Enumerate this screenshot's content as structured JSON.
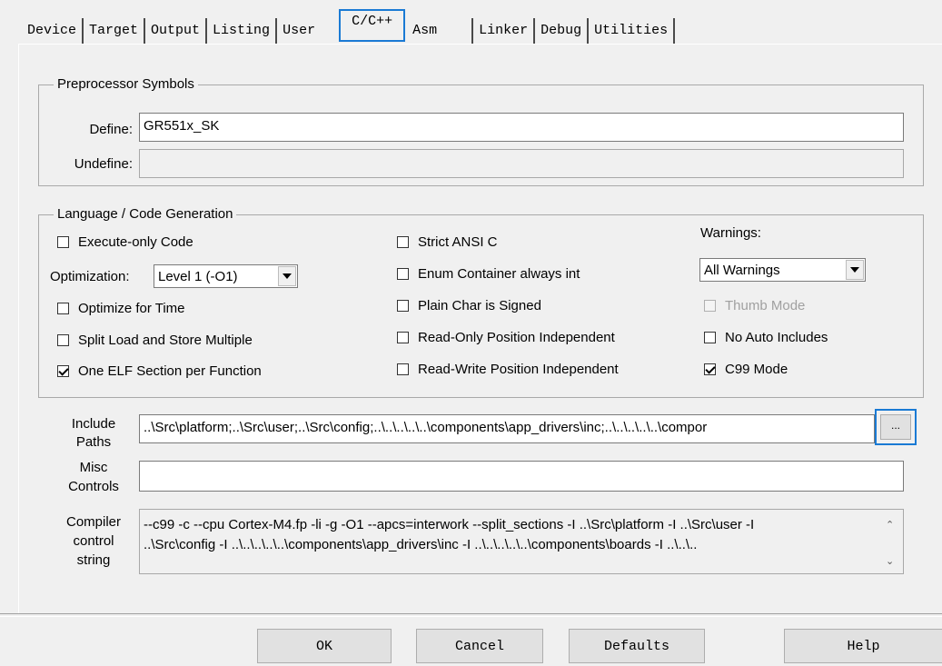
{
  "tabs": [
    {
      "label": "Device"
    },
    {
      "label": "Target"
    },
    {
      "label": "Output"
    },
    {
      "label": "Listing"
    },
    {
      "label": "User"
    },
    {
      "label": "C/C++",
      "active": true
    },
    {
      "label": "Asm"
    },
    {
      "label": "Linker"
    },
    {
      "label": "Debug"
    },
    {
      "label": "Utilities"
    }
  ],
  "preprocessor": {
    "title": "Preprocessor Symbols",
    "define_label": "Define:",
    "define_value": "GR551x_SK",
    "undefine_label": "Undefine:",
    "undefine_value": ""
  },
  "language": {
    "title": "Language / Code Generation",
    "options": [
      {
        "label": "Execute-only Code",
        "checked": false
      },
      {
        "label": "Optimize for Time",
        "checked": false
      },
      {
        "label": "Split Load and Store Multiple",
        "checked": false
      },
      {
        "label": "One ELF Section per Function",
        "checked": true
      },
      {
        "label": "Strict ANSI C",
        "checked": false
      },
      {
        "label": "Enum Container always int",
        "checked": false
      },
      {
        "label": "Plain Char is Signed",
        "checked": false
      },
      {
        "label": "Read-Only Position Independent",
        "checked": false
      },
      {
        "label": "Read-Write Position Independent",
        "checked": false
      },
      {
        "label": "Thumb Mode",
        "checked": false,
        "disabled": true
      },
      {
        "label": "No Auto Includes",
        "checked": false
      },
      {
        "label": "C99 Mode",
        "checked": true
      }
    ],
    "optimization_label": "Optimization:",
    "optimization_value": "Level 1 (-O1)",
    "warnings_label": "Warnings:",
    "warnings_value": "All Warnings"
  },
  "include": {
    "label_line1": "Include",
    "label_line2": "Paths",
    "value": "..\\Src\\platform;..\\Src\\user;..\\Src\\config;..\\..\\..\\..\\..\\components\\app_drivers\\inc;..\\..\\..\\..\\..\\compor",
    "browse_label": "..."
  },
  "misc": {
    "label_line1": "Misc",
    "label_line2": "Controls",
    "value": ""
  },
  "compiler": {
    "label_line1": "Compiler",
    "label_line2": "control",
    "label_line3": "string",
    "line1": "--c99 -c --cpu Cortex-M4.fp -li -g -O1 --apcs=interwork --split_sections -I ..\\Src\\platform -I ..\\Src\\user -I",
    "line2": "..\\Src\\config -I ..\\..\\..\\..\\..\\components\\app_drivers\\inc -I ..\\..\\..\\..\\..\\components\\boards -I ..\\..\\.."
  },
  "buttons": {
    "ok": "OK",
    "cancel": "Cancel",
    "defaults": "Defaults",
    "help": "Help"
  }
}
